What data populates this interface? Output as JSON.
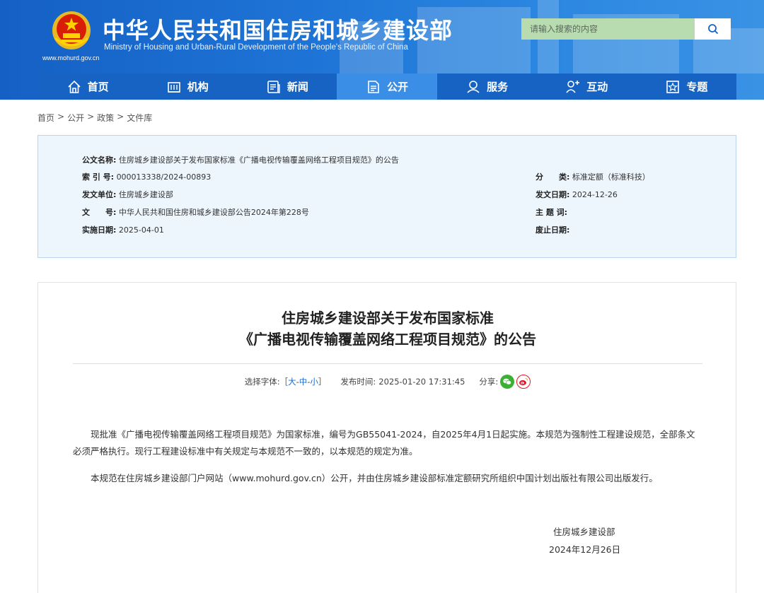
{
  "header": {
    "title_cn": "中华人民共和国住房和城乡建设部",
    "title_en": "Ministry of Housing and Urban-Rural Development of the People's Republic of China",
    "site_url": "www.mohurd.gov.cn",
    "search": {
      "placeholder": "请输入搜索的内容",
      "icon": "search-icon"
    }
  },
  "nav": [
    {
      "label": "首页",
      "icon": "home-icon"
    },
    {
      "label": "机构",
      "icon": "organization-icon"
    },
    {
      "label": "新闻",
      "icon": "news-icon"
    },
    {
      "label": "公开",
      "icon": "disclosure-icon",
      "active": true
    },
    {
      "label": "服务",
      "icon": "service-icon"
    },
    {
      "label": "互动",
      "icon": "interaction-icon"
    },
    {
      "label": "专题",
      "icon": "topic-icon"
    }
  ],
  "breadcrumb": [
    "首页",
    "公开",
    "政策",
    "文件库"
  ],
  "breadcrumb_sep": ">",
  "info": {
    "doc_name": {
      "label": "公文名称:",
      "value": "住房城乡建设部关于发布国家标准《广播电视传输覆盖网络工程项目规范》的公告"
    },
    "index_no": {
      "label": "索 引 号:",
      "value": "000013338/2024-00893"
    },
    "issuer": {
      "label": "发文单位:",
      "value": "住房城乡建设部"
    },
    "doc_no": {
      "label": "文　　号:",
      "value": "中华人民共和国住房和城乡建设部公告2024年第228号"
    },
    "effective_date": {
      "label": "实施日期:",
      "value": "2025-04-01"
    },
    "category": {
      "label": "分　　类:",
      "value": "标准定额（标准科技）"
    },
    "issue_date": {
      "label": "发文日期:",
      "value": "2024-12-26"
    },
    "subject": {
      "label": "主 题 词:",
      "value": ""
    },
    "expiry_date": {
      "label": "废止日期:",
      "value": ""
    }
  },
  "article": {
    "title_line1": "住房城乡建设部关于发布国家标准",
    "title_line2": "《广播电视传输覆盖网络工程项目规范》的公告",
    "font_size_label": "选择字体:［",
    "font_size_options": [
      "大",
      "中",
      "小"
    ],
    "font_size_close": "］",
    "publish_label": "发布时间:",
    "publish_time": "2025-01-20 17:31:45",
    "share_label": "分享:",
    "share_icons": [
      "wechat-icon",
      "weibo-icon"
    ],
    "paragraph1": "现批准《广播电视传输覆盖网络工程项目规范》为国家标准，编号为GB55041-2024，自2025年4月1日起实施。本规范为强制性工程建设规范，全部条文必须严格执行。现行工程建设标准中有关规定与本规范不一致的，以本规范的规定为准。",
    "paragraph2": "本规范在住房城乡建设部门户网站（www.mohurd.gov.cn）公开，并由住房城乡建设部标准定额研究所组织中国计划出版社有限公司出版发行。",
    "signature_org": "住房城乡建设部",
    "signature_date": "2024年12月26日"
  },
  "colors": {
    "header_blue": "#1e74d6",
    "nav_blue": "#1763c4",
    "nav_active": "#3a8ee6",
    "info_bg": "#eef6fd",
    "link_blue": "#1a6cc8",
    "wechat_green": "#3cb035",
    "weibo_red": "#e6162d"
  }
}
